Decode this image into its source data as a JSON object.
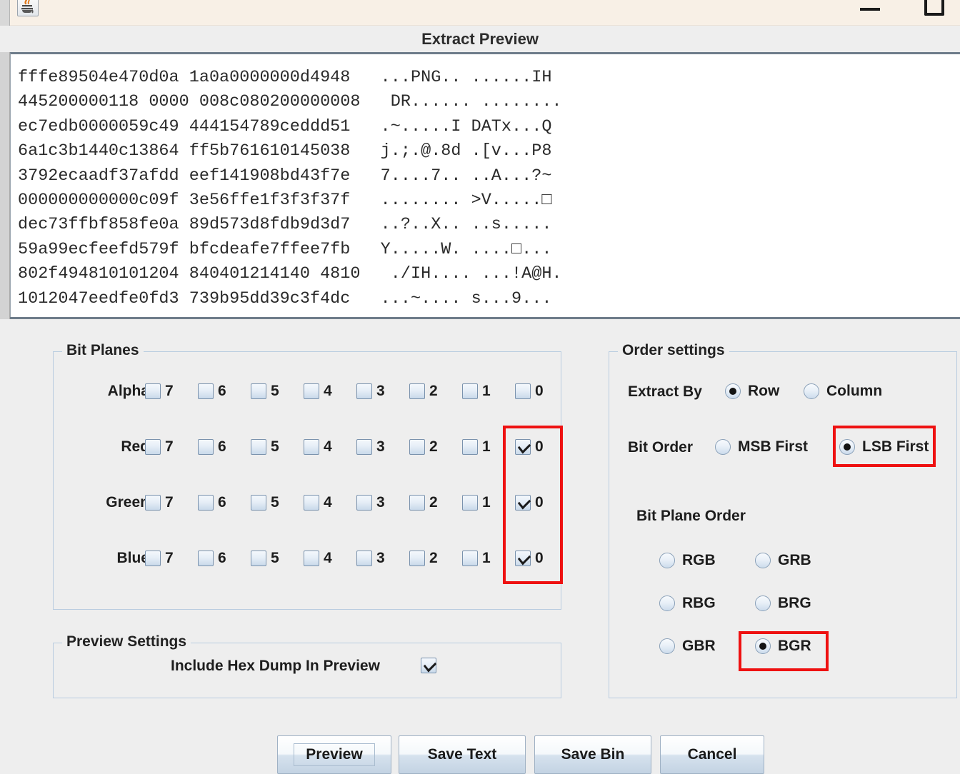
{
  "window": {
    "app_icon": "java-coffee-cup-icon",
    "minimize_label": "—",
    "maximize_label": "□"
  },
  "header": {
    "title": "Extract Preview"
  },
  "hex_preview": {
    "lines": [
      "fffe89504e470d0a 1a0a0000000d4948   ...PNG.. ......IH",
      "445200000118 0000 008c080200000008   DR...... ........",
      "ec7edb0000059c49 444154789ceddd51   .~.....I DATx...Q",
      "6a1c3b1440c13864 ff5b761610145038   j.;.@.8d .[v...P8",
      "3792ecaadf37afdd eef141908bd43f7e   7....7.. ..A...?~",
      "000000000000c09f 3e56ffe1f3f3f37f   ........ >V.....□",
      "dec73ffbf858fe0a 89d573d8fdb9d3d7   ..?..X.. ..s.....",
      "59a99ecfeefd579f bfcdeafe7ffee7fb   Y.....W. ....□...",
      "802f494810101204 840401214140 4810   ./IH.... ...!A@H.",
      "1012047eedfe0fd3 739b95dd39c3f4dc   ...~.... s...9..."
    ]
  },
  "bit_planes": {
    "title": "Bit Planes",
    "bit_labels": [
      "7",
      "6",
      "5",
      "4",
      "3",
      "2",
      "1",
      "0"
    ],
    "rows": [
      {
        "label": "Alpha",
        "checked": [
          false,
          false,
          false,
          false,
          false,
          false,
          false,
          false
        ]
      },
      {
        "label": "Red",
        "checked": [
          false,
          false,
          false,
          false,
          false,
          false,
          false,
          true
        ]
      },
      {
        "label": "Green",
        "checked": [
          false,
          false,
          false,
          false,
          false,
          false,
          false,
          true
        ]
      },
      {
        "label": "Blue",
        "checked": [
          false,
          false,
          false,
          false,
          false,
          false,
          false,
          true
        ]
      }
    ]
  },
  "preview_settings": {
    "title": "Preview Settings",
    "include_hex_dump_label": "Include Hex Dump In Preview",
    "include_hex_dump_checked": true
  },
  "order_settings": {
    "title": "Order settings",
    "extract_by_label": "Extract By",
    "extract_by_options": [
      {
        "label": "Row",
        "selected": true
      },
      {
        "label": "Column",
        "selected": false
      }
    ],
    "bit_order_label": "Bit Order",
    "bit_order_options": [
      {
        "label": "MSB First",
        "selected": false
      },
      {
        "label": "LSB First",
        "selected": true
      }
    ],
    "bit_plane_order_label": "Bit Plane Order",
    "bit_plane_order_options": [
      {
        "label": "RGB",
        "selected": false
      },
      {
        "label": "GRB",
        "selected": false
      },
      {
        "label": "RBG",
        "selected": false
      },
      {
        "label": "BRG",
        "selected": false
      },
      {
        "label": "GBR",
        "selected": false
      },
      {
        "label": "BGR",
        "selected": true
      }
    ]
  },
  "buttons": {
    "preview": "Preview",
    "save_text": "Save Text",
    "save_bin": "Save Bin",
    "cancel": "Cancel"
  },
  "colors": {
    "highlight": "#ee1111",
    "titlebar": "#f8f0e6",
    "panel_bg": "#eeeeee",
    "panel_border": "#b9cce0"
  }
}
